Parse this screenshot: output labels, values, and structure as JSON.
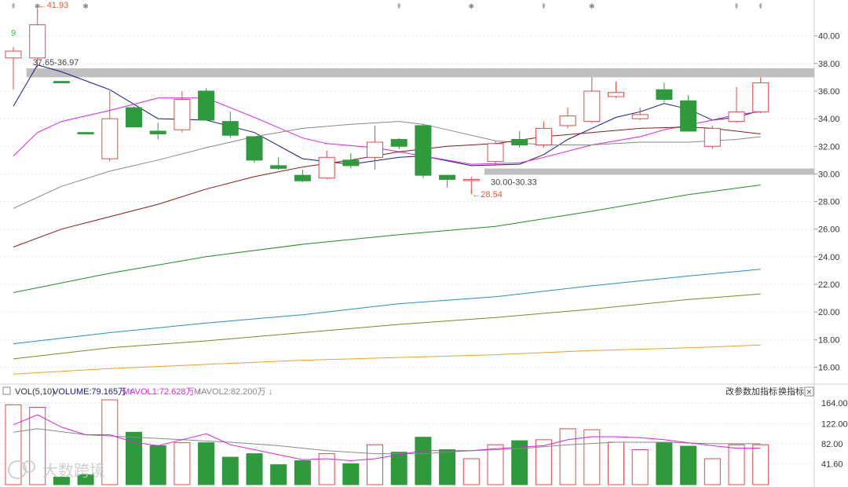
{
  "chart_data": [
    {
      "type": "candlestick",
      "y_ticks": [
        "40.00",
        "38.00",
        "36.00",
        "34.00",
        "32.00",
        "30.00",
        "28.00",
        "26.00",
        "24.00",
        "22.00",
        "20.00",
        "18.00",
        "16.00"
      ],
      "ylim": [
        15.0,
        42.6
      ],
      "grid": true,
      "colors": {
        "up": "#e04a4a",
        "down": "#2e9a3c",
        "grid": "#e4e4e4",
        "band": "#b8b8b8"
      },
      "candles": [
        {
          "o": 38.4,
          "h": 39.2,
          "l": 36.1,
          "c": 38.9
        },
        {
          "o": 38.4,
          "h": 41.93,
          "l": 37.7,
          "c": 40.8
        },
        {
          "o": 36.7,
          "h": 36.7,
          "l": 36.6,
          "c": 36.6
        },
        {
          "o": 33.0,
          "h": 33.0,
          "l": 32.9,
          "c": 32.9
        },
        {
          "o": 31.1,
          "h": 36.0,
          "l": 30.9,
          "c": 34.0
        },
        {
          "o": 34.8,
          "h": 34.9,
          "l": 33.4,
          "c": 33.4
        },
        {
          "o": 33.1,
          "h": 33.7,
          "l": 32.5,
          "c": 32.9
        },
        {
          "o": 33.2,
          "h": 36.0,
          "l": 33.0,
          "c": 35.4
        },
        {
          "o": 36.0,
          "h": 36.2,
          "l": 33.9,
          "c": 33.9
        },
        {
          "o": 33.8,
          "h": 34.5,
          "l": 32.6,
          "c": 32.8
        },
        {
          "o": 32.7,
          "h": 32.7,
          "l": 30.8,
          "c": 31.0
        },
        {
          "o": 30.6,
          "h": 31.2,
          "l": 30.3,
          "c": 30.4
        },
        {
          "o": 29.9,
          "h": 30.3,
          "l": 29.4,
          "c": 29.5
        },
        {
          "o": 29.7,
          "h": 31.7,
          "l": 29.6,
          "c": 31.2
        },
        {
          "o": 31.0,
          "h": 31.5,
          "l": 30.4,
          "c": 30.6
        },
        {
          "o": 31.2,
          "h": 33.5,
          "l": 30.3,
          "c": 32.3
        },
        {
          "o": 32.5,
          "h": 32.6,
          "l": 31.8,
          "c": 32.0
        },
        {
          "o": 33.5,
          "h": 33.6,
          "l": 29.7,
          "c": 29.9
        },
        {
          "o": 29.9,
          "h": 29.9,
          "l": 29.0,
          "c": 29.6
        },
        {
          "o": 29.6,
          "h": 29.8,
          "l": 28.54,
          "c": 29.6
        },
        {
          "o": 30.9,
          "h": 32.4,
          "l": 30.6,
          "c": 32.2
        },
        {
          "o": 32.5,
          "h": 33.1,
          "l": 31.9,
          "c": 32.1
        },
        {
          "o": 32.1,
          "h": 33.8,
          "l": 31.9,
          "c": 33.3
        },
        {
          "o": 33.5,
          "h": 34.8,
          "l": 33.3,
          "c": 34.2
        },
        {
          "o": 33.8,
          "h": 37.0,
          "l": 33.7,
          "c": 36.0
        },
        {
          "o": 35.6,
          "h": 36.7,
          "l": 35.5,
          "c": 35.9
        },
        {
          "o": 34.0,
          "h": 34.8,
          "l": 33.9,
          "c": 34.3
        },
        {
          "o": 36.1,
          "h": 36.6,
          "l": 35.2,
          "c": 35.4
        },
        {
          "o": 35.3,
          "h": 35.7,
          "l": 33.1,
          "c": 33.1
        },
        {
          "o": 32.0,
          "h": 33.5,
          "l": 31.8,
          "c": 33.3
        },
        {
          "o": 33.8,
          "h": 36.3,
          "l": 33.7,
          "c": 34.5
        },
        {
          "o": 34.5,
          "h": 37.0,
          "l": 34.4,
          "c": 36.6
        }
      ],
      "ma_lines": [
        {
          "color": "#1a1a80",
          "points": [
            [
              0,
              34.9
            ],
            [
              1,
              37.9
            ],
            [
              2,
              37.4
            ],
            [
              4,
              36.1
            ],
            [
              6,
              34.0
            ],
            [
              8,
              33.9
            ],
            [
              10,
              33.0
            ],
            [
              12,
              31.1
            ],
            [
              14,
              30.7
            ],
            [
              16,
              31.2
            ],
            [
              17,
              31.3
            ],
            [
              19,
              30.6
            ],
            [
              21,
              30.7
            ],
            [
              22,
              31.4
            ],
            [
              23,
              32.5
            ],
            [
              25,
              34.1
            ],
            [
              26,
              34.5
            ],
            [
              27,
              35.1
            ],
            [
              28,
              34.7
            ],
            [
              29,
              33.9
            ],
            [
              30,
              34.1
            ],
            [
              31,
              34.6
            ]
          ]
        },
        {
          "color": "#e020e0",
          "points": [
            [
              0,
              31.3
            ],
            [
              1,
              33.0
            ],
            [
              2,
              33.8
            ],
            [
              4,
              34.6
            ],
            [
              6,
              35.5
            ],
            [
              8,
              35.5
            ],
            [
              10,
              34.1
            ],
            [
              12,
              32.6
            ],
            [
              13,
              32.2
            ],
            [
              15,
              31.9
            ],
            [
              17,
              31.3
            ],
            [
              19,
              30.7
            ],
            [
              21,
              30.8
            ],
            [
              22,
              31.2
            ],
            [
              24,
              32.1
            ],
            [
              26,
              32.7
            ],
            [
              27,
              33.2
            ],
            [
              29,
              33.9
            ],
            [
              30,
              34.3
            ],
            [
              31,
              34.5
            ]
          ]
        },
        {
          "color": "#888888",
          "points": [
            [
              0,
              27.5
            ],
            [
              2,
              29.1
            ],
            [
              4,
              30.2
            ],
            [
              6,
              31.0
            ],
            [
              8,
              31.9
            ],
            [
              10,
              32.7
            ],
            [
              12,
              33.3
            ],
            [
              14,
              33.6
            ],
            [
              16,
              33.8
            ],
            [
              17,
              33.6
            ],
            [
              18,
              33.2
            ],
            [
              20,
              32.4
            ],
            [
              22,
              32.1
            ],
            [
              24,
              32.1
            ],
            [
              26,
              32.3
            ],
            [
              28,
              32.3
            ],
            [
              30,
              32.5
            ],
            [
              31,
              32.7
            ]
          ]
        },
        {
          "color": "#8b1a1a",
          "points": [
            [
              0,
              24.7
            ],
            [
              2,
              26.0
            ],
            [
              4,
              26.9
            ],
            [
              6,
              27.8
            ],
            [
              8,
              28.9
            ],
            [
              10,
              29.8
            ],
            [
              12,
              30.5
            ],
            [
              14,
              31.0
            ],
            [
              16,
              31.6
            ],
            [
              18,
              32.0
            ],
            [
              20,
              32.2
            ],
            [
              22,
              32.7
            ],
            [
              24,
              33.0
            ],
            [
              26,
              33.3
            ],
            [
              28,
              33.4
            ],
            [
              29,
              33.3
            ],
            [
              31,
              32.9
            ]
          ]
        },
        {
          "color": "#228b22",
          "points": [
            [
              0,
              21.4
            ],
            [
              4,
              22.8
            ],
            [
              8,
              24.0
            ],
            [
              12,
              24.9
            ],
            [
              16,
              25.6
            ],
            [
              20,
              26.2
            ],
            [
              24,
              27.3
            ],
            [
              28,
              28.5
            ],
            [
              31,
              29.2
            ]
          ]
        },
        {
          "color": "#2a8ac8",
          "points": [
            [
              0,
              17.7
            ],
            [
              4,
              18.5
            ],
            [
              8,
              19.2
            ],
            [
              12,
              19.8
            ],
            [
              16,
              20.6
            ],
            [
              20,
              21.1
            ],
            [
              24,
              21.9
            ],
            [
              28,
              22.6
            ],
            [
              31,
              23.1
            ]
          ]
        },
        {
          "color": "#7a8a20",
          "points": [
            [
              0,
              16.6
            ],
            [
              4,
              17.4
            ],
            [
              8,
              17.9
            ],
            [
              12,
              18.5
            ],
            [
              16,
              19.1
            ],
            [
              20,
              19.6
            ],
            [
              24,
              20.2
            ],
            [
              28,
              20.9
            ],
            [
              31,
              21.3
            ]
          ]
        },
        {
          "color": "#f0a020",
          "points": [
            [
              0,
              15.5
            ],
            [
              4,
              15.9
            ],
            [
              8,
              16.2
            ],
            [
              12,
              16.5
            ],
            [
              16,
              16.7
            ],
            [
              20,
              16.9
            ],
            [
              24,
              17.2
            ],
            [
              28,
              17.4
            ],
            [
              31,
              17.6
            ]
          ]
        }
      ],
      "bands": [
        {
          "from_index": 1,
          "y_low": 37.0,
          "y_high": 37.65,
          "label": "37.65-36.97"
        },
        {
          "from_index": 20,
          "y_low": 30.0,
          "y_high": 30.33,
          "label": "30.00-30.33"
        }
      ],
      "annotations": [
        {
          "label": "←41.93",
          "index": 1,
          "y": 41.93,
          "color": "#e05a2a"
        },
        {
          "label": "←28.54",
          "index": 19,
          "y": 28.54,
          "color": "#e05a2a"
        },
        {
          "label": "9",
          "index": 0,
          "y": 39.2,
          "color": "#22cc22"
        }
      ],
      "event_marks": [
        {
          "index": 0,
          "glyph": "⇞"
        },
        {
          "index": 1,
          "glyph": "✱"
        },
        {
          "index": 3,
          "glyph": "✱"
        },
        {
          "index": 16,
          "glyph": "⇞"
        },
        {
          "index": 19,
          "glyph": "✱"
        },
        {
          "index": 22,
          "glyph": "⇞"
        },
        {
          "index": 24,
          "glyph": "✱"
        },
        {
          "index": 30,
          "glyph": "⇞"
        },
        {
          "index": 31,
          "glyph": "⇞"
        }
      ]
    },
    {
      "type": "bar",
      "indicator_label": "VOL(5,10)",
      "volume_label": "VOLUME:79.165万",
      "volume_arrow": "↑",
      "mavol1_label": "MAVOL1:72.628万",
      "mavol1_arrow": "↑",
      "mavol2_label": "MAVOL2:82.200万",
      "mavol2_arrow": "↓",
      "y_ticks": [
        "164.00",
        "122.00",
        "82.00",
        "41.60"
      ],
      "ylim": [
        0,
        170
      ],
      "volumes": [
        160,
        155,
        15,
        20,
        170,
        105,
        78,
        84,
        84,
        55,
        62,
        40,
        48,
        62,
        42,
        80,
        65,
        95,
        70,
        52,
        80,
        88,
        90,
        112,
        110,
        85,
        70,
        85,
        77,
        52,
        80,
        80
      ],
      "mavol1_points": [
        [
          0,
          120
        ],
        [
          1,
          140
        ],
        [
          2,
          115
        ],
        [
          3,
          100
        ],
        [
          4,
          100
        ],
        [
          5,
          85
        ],
        [
          6,
          78
        ],
        [
          7,
          90
        ],
        [
          8,
          102
        ],
        [
          9,
          80
        ],
        [
          10,
          70
        ],
        [
          11,
          60
        ],
        [
          12,
          50
        ],
        [
          13,
          52
        ],
        [
          14,
          48
        ],
        [
          15,
          52
        ],
        [
          16,
          60
        ],
        [
          17,
          68
        ],
        [
          19,
          68
        ],
        [
          20,
          72
        ],
        [
          22,
          78
        ],
        [
          23,
          90
        ],
        [
          24,
          96
        ],
        [
          25,
          96
        ],
        [
          26,
          94
        ],
        [
          27,
          90
        ],
        [
          28,
          84
        ],
        [
          29,
          78
        ],
        [
          30,
          73
        ],
        [
          31,
          73
        ]
      ],
      "mavol2_points": [
        [
          0,
          105
        ],
        [
          1,
          112
        ],
        [
          3,
          100
        ],
        [
          5,
          95
        ],
        [
          7,
          90
        ],
        [
          9,
          85
        ],
        [
          11,
          78
        ],
        [
          13,
          68
        ],
        [
          15,
          62
        ],
        [
          17,
          62
        ],
        [
          19,
          68
        ],
        [
          21,
          72
        ],
        [
          23,
          80
        ],
        [
          25,
          85
        ],
        [
          27,
          85
        ],
        [
          29,
          82
        ],
        [
          31,
          82
        ]
      ],
      "colors": {
        "mavol1": "#e020e0",
        "mavol2": "#888888",
        "label_dark": "#1a1a80"
      }
    }
  ],
  "toolbar": {
    "params": "改参数",
    "add_indicator": "加指标",
    "switch_indicator": "换指标",
    "close_glyph": "✕"
  },
  "watermark": "大数跨境"
}
